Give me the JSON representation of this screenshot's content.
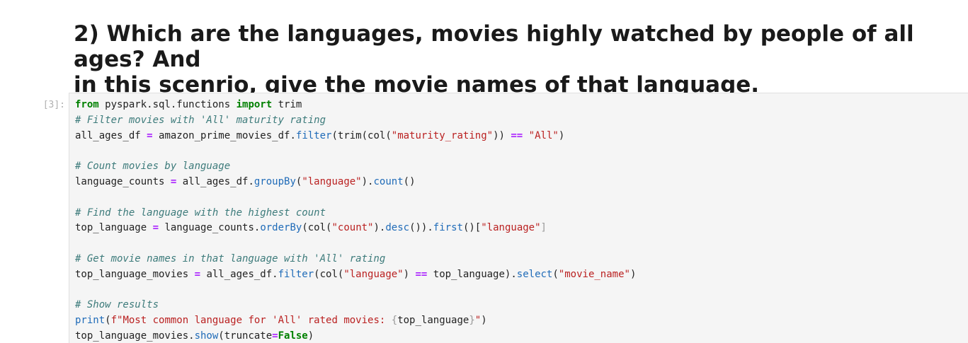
{
  "heading": "2) Which are the languages, movies highly watched by people of all ages? And\nin this scenrio, give the movie names of that language.",
  "cell": {
    "prompt": "[3]:",
    "lines": [
      [
        {
          "t": "from",
          "c": "kw"
        },
        {
          "t": " pyspark.sql.functions "
        },
        {
          "t": "import",
          "c": "kw"
        },
        {
          "t": " trim"
        }
      ],
      [
        {
          "t": "# Filter movies with 'All' maturity rating",
          "c": "com"
        }
      ],
      [
        {
          "t": "all_ages_df "
        },
        {
          "t": "=",
          "c": "op"
        },
        {
          "t": " amazon_prime_movies_df."
        },
        {
          "t": "filter",
          "c": "attr"
        },
        {
          "t": "(trim(col("
        },
        {
          "t": "\"maturity_rating\"",
          "c": "str"
        },
        {
          "t": ")) "
        },
        {
          "t": "==",
          "c": "op"
        },
        {
          "t": " "
        },
        {
          "t": "\"All\"",
          "c": "str"
        },
        {
          "t": ")"
        }
      ],
      [],
      [
        {
          "t": "# Count movies by language",
          "c": "com"
        }
      ],
      [
        {
          "t": "language_counts "
        },
        {
          "t": "=",
          "c": "op"
        },
        {
          "t": " all_ages_df."
        },
        {
          "t": "groupBy",
          "c": "attr"
        },
        {
          "t": "("
        },
        {
          "t": "\"language\"",
          "c": "str"
        },
        {
          "t": ")."
        },
        {
          "t": "count",
          "c": "attr"
        },
        {
          "t": "()"
        }
      ],
      [],
      [
        {
          "t": "# Find the language with the highest count",
          "c": "com"
        }
      ],
      [
        {
          "t": "top_language "
        },
        {
          "t": "=",
          "c": "op"
        },
        {
          "t": " language_counts."
        },
        {
          "t": "orderBy",
          "c": "attr"
        },
        {
          "t": "(col("
        },
        {
          "t": "\"count\"",
          "c": "str"
        },
        {
          "t": ")."
        },
        {
          "t": "desc",
          "c": "attr"
        },
        {
          "t": "())."
        },
        {
          "t": "first",
          "c": "attr"
        },
        {
          "t": "()["
        },
        {
          "t": "\"language\"",
          "c": "str"
        },
        {
          "t": "]",
          "c": "brk"
        }
      ],
      [],
      [
        {
          "t": "# Get movie names in that language with 'All' rating",
          "c": "com"
        }
      ],
      [
        {
          "t": "top_language_movies "
        },
        {
          "t": "=",
          "c": "op"
        },
        {
          "t": " all_ages_df."
        },
        {
          "t": "filter",
          "c": "attr"
        },
        {
          "t": "(col("
        },
        {
          "t": "\"language\"",
          "c": "str"
        },
        {
          "t": ") "
        },
        {
          "t": "==",
          "c": "op"
        },
        {
          "t": " top_language)."
        },
        {
          "t": "select",
          "c": "attr"
        },
        {
          "t": "("
        },
        {
          "t": "\"movie_name\"",
          "c": "str"
        },
        {
          "t": ")"
        }
      ],
      [],
      [
        {
          "t": "# Show results",
          "c": "com"
        }
      ],
      [
        {
          "t": "print",
          "c": "attr"
        },
        {
          "t": "("
        },
        {
          "t": "f\"Most common language for 'All' rated movies: ",
          "c": "str"
        },
        {
          "t": "{",
          "c": "brk"
        },
        {
          "t": "top_language"
        },
        {
          "t": "}",
          "c": "brk"
        },
        {
          "t": "\"",
          "c": "str"
        },
        {
          "t": ")"
        }
      ],
      [
        {
          "t": "top_language_movies."
        },
        {
          "t": "show",
          "c": "attr"
        },
        {
          "t": "(truncate"
        },
        {
          "t": "=",
          "c": "op"
        },
        {
          "t": "False",
          "c": "bool"
        },
        {
          "t": ")"
        }
      ]
    ]
  }
}
